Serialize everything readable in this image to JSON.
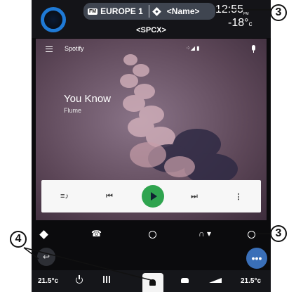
{
  "top_bar": {
    "fm_badge": "FM",
    "station": "EUROPE 1",
    "route_name": "<Name>",
    "clock": "12:55",
    "clock_suffix": "PM",
    "temperature": "-18°",
    "temperature_unit": "c",
    "device_label": "<SPCX>"
  },
  "spotify": {
    "app_name": "Spotify",
    "signal_text": "⁘◢ ▮",
    "track_title": "You Know",
    "track_artist": "Flume",
    "accent_color": "#2fa44f",
    "controls": {
      "queue": "≡♪",
      "prev": "⏮",
      "next": "⏭",
      "more": "⋮"
    }
  },
  "android_auto_bar": {
    "phone": "☎",
    "audio": "∩ ▾"
  },
  "fabs": {
    "back": "↩",
    "overflow": "•••",
    "overflow_color": "#3a6fb8"
  },
  "vehicle_bar": {
    "temp_left": "21.5°c",
    "temp_right": "21.5°c"
  },
  "callouts": {
    "top_right": "3",
    "bottom_right": "3",
    "bottom_left": "4"
  }
}
